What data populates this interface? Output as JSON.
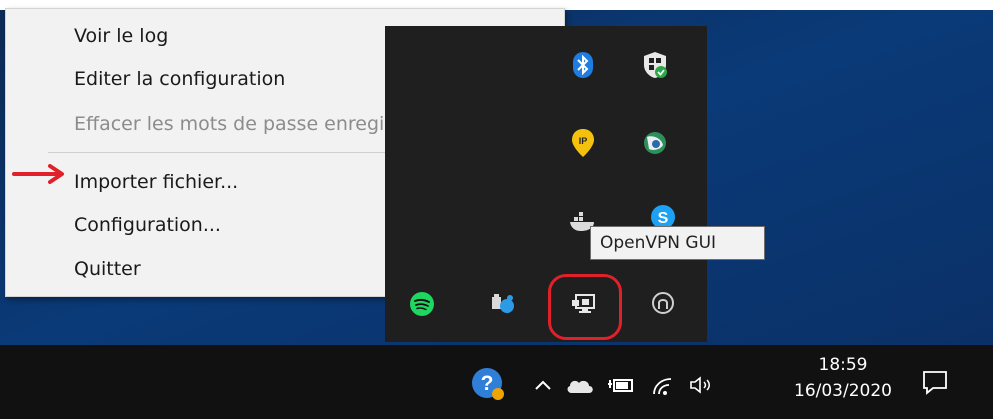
{
  "menu": {
    "items": [
      {
        "label": "Voir le log",
        "enabled": true
      },
      {
        "label": "Editer la configuration",
        "enabled": true
      },
      {
        "label": "Effacer les mots de passe enregistrés",
        "enabled": false
      },
      {
        "label": "Importer fichier...",
        "enabled": true
      },
      {
        "label": "Configuration...",
        "enabled": true
      },
      {
        "label": "Quitter",
        "enabled": true
      }
    ]
  },
  "tooltip": {
    "text": "OpenVPN GUI"
  },
  "tray_icons": [
    "bluetooth-icon",
    "windows-security-icon",
    "ip-location-icon",
    "globe-app-icon",
    "docker-icon",
    "skype-icon",
    "spotify-icon",
    "teams-like-icon",
    "openvpn-gui-icon",
    "steelseries-icon"
  ],
  "taskbar": {
    "clock_time": "18:59",
    "clock_date": "16/03/2020",
    "icons": [
      "help-icon",
      "show-hidden-icons-chevron",
      "onedrive-icon",
      "battery-icon",
      "wifi-icon",
      "volume-icon",
      "notifications-icon"
    ]
  },
  "colors": {
    "highlight": "#e0202a",
    "taskbar": "#111111",
    "menu_bg": "#f2f2f2"
  }
}
